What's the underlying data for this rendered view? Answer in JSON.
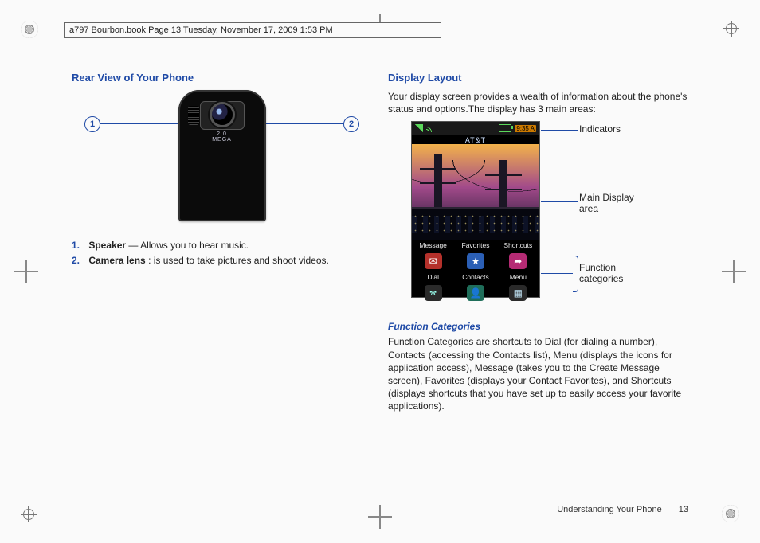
{
  "header_text": "a797 Bourbon.book  Page 13  Tuesday, November 17, 2009  1:53 PM",
  "left": {
    "heading": "Rear View of Your Phone",
    "callouts": {
      "n1": "1",
      "n2": "2"
    },
    "camera_mp_line1": "2.0",
    "camera_mp_line2": "MEGA",
    "items": [
      {
        "num": "1.",
        "term": "Speaker",
        "desc": " — Allows you to hear music."
      },
      {
        "num": "2.",
        "term": "Camera lens",
        "desc": ": is used to take pictures and shoot videos."
      }
    ]
  },
  "right": {
    "heading": "Display Layout",
    "intro": "Your display screen provides a wealth of information about the phone's status and options.The display has 3 main areas:",
    "screen": {
      "carrier": "AT&T",
      "clock": "9:35 A",
      "row1": {
        "a": "Message",
        "b": "Favorites",
        "c": "Shortcuts"
      },
      "row2": {
        "a": "Dial",
        "b": "Contacts",
        "c": "Menu"
      },
      "glyphs": {
        "msg": "✉",
        "fav": "★",
        "short": "➦",
        "dial": "🕿",
        "contacts": "👤",
        "menu": "▦"
      }
    },
    "annot": {
      "indicators": "Indicators",
      "main1": "Main Display",
      "main2": "area",
      "fn1": "Function",
      "fn2": "categories"
    },
    "sub_heading": "Function Categories",
    "fn_body": "Function Categories are shortcuts to Dial (for dialing a number), Contacts (accessing the Contacts list), Menu (displays the icons for application access), Message (takes you to the Create Message screen), Favorites (displays your Contact Favorites), and Shortcuts (displays shortcuts that you have set up to easily access your favorite applications)."
  },
  "footer": {
    "section": "Understanding Your Phone",
    "page": "13"
  }
}
